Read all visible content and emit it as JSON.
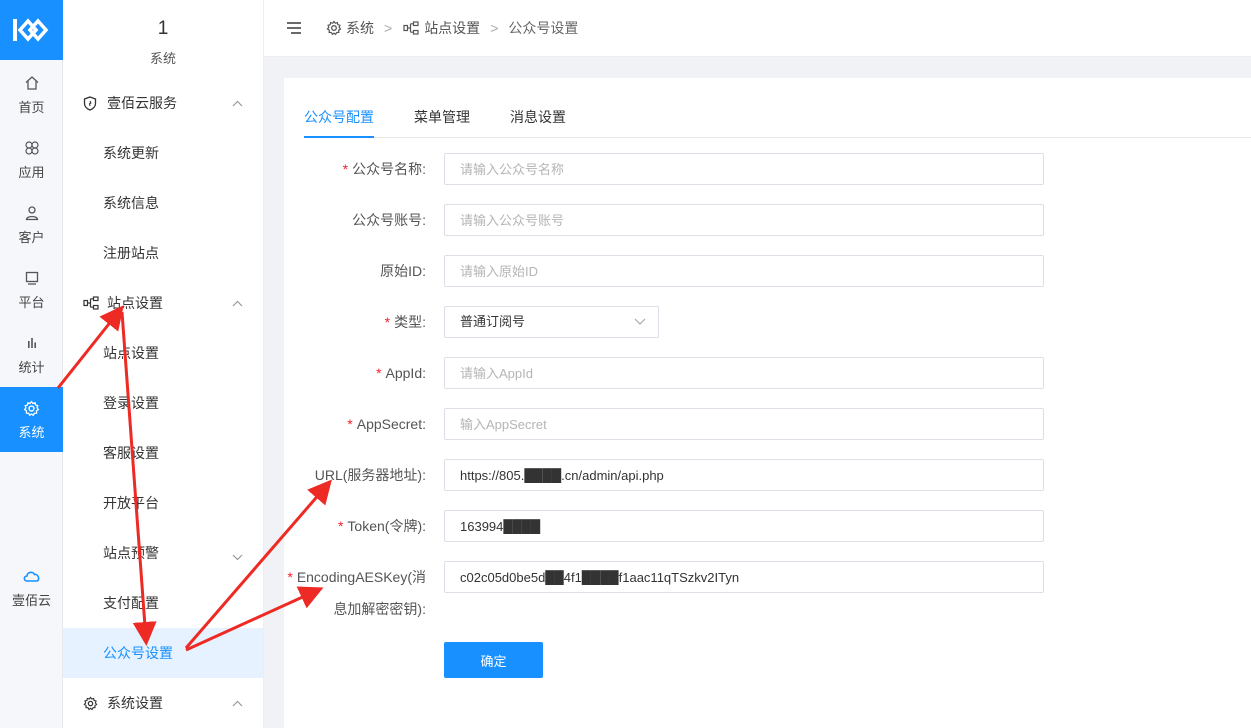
{
  "rail": {
    "items": [
      {
        "label": "首页",
        "icon": "home-icon"
      },
      {
        "label": "应用",
        "icon": "apps-icon"
      },
      {
        "label": "客户",
        "icon": "user-icon"
      },
      {
        "label": "平台",
        "icon": "monitor-icon"
      },
      {
        "label": "统计",
        "icon": "bar-chart-icon"
      },
      {
        "label": "系统",
        "icon": "gear-icon",
        "active": true
      }
    ],
    "bottom": {
      "label": "壹佰云",
      "icon": "cloud-icon"
    }
  },
  "sidebar": {
    "head_number": "1",
    "head_label": "系统",
    "groups": [
      {
        "label": "壹佰云服务",
        "items": [
          "系统更新",
          "系统信息",
          "注册站点"
        ]
      },
      {
        "label": "站点设置",
        "items": [
          "站点设置",
          "登录设置",
          "客服设置",
          "开放平台",
          "站点预警",
          "支付配置",
          "公众号设置"
        ]
      },
      {
        "label": "系统设置",
        "items": []
      }
    ]
  },
  "header": {
    "breadcrumb": [
      "系统",
      "站点设置",
      "公众号设置"
    ],
    "separator": ">"
  },
  "tabs": [
    "公众号配置",
    "菜单管理",
    "消息设置"
  ],
  "form": {
    "name": {
      "label": "公众号名称:",
      "placeholder": "请输入公众号名称",
      "value": ""
    },
    "account": {
      "label": "公众号账号:",
      "placeholder": "请输入公众号账号",
      "value": ""
    },
    "origin_id": {
      "label": "原始ID:",
      "placeholder": "请输入原始ID",
      "value": ""
    },
    "type": {
      "label": "类型:",
      "value": "普通订阅号"
    },
    "appid": {
      "label": "AppId:",
      "placeholder": "请输入AppId",
      "value": ""
    },
    "appsecret": {
      "label": "AppSecret:",
      "placeholder": "输入AppSecret",
      "value": ""
    },
    "url": {
      "label": "URL(服务器地址):",
      "value": "https://805.████.cn/admin/api.php"
    },
    "token": {
      "label": "Token(令牌):",
      "value": "163994████"
    },
    "aes": {
      "label_line1": "EncodingAESKey(消",
      "label_line2": "息加解密密钥):",
      "value": "c02c05d0be5d██4f1████f1aac11qTSzkv2ITyn"
    },
    "submit": "确定"
  },
  "colors": {
    "primary": "#1890ff",
    "required": "#f5222d",
    "annotation": "#ee2a24"
  }
}
